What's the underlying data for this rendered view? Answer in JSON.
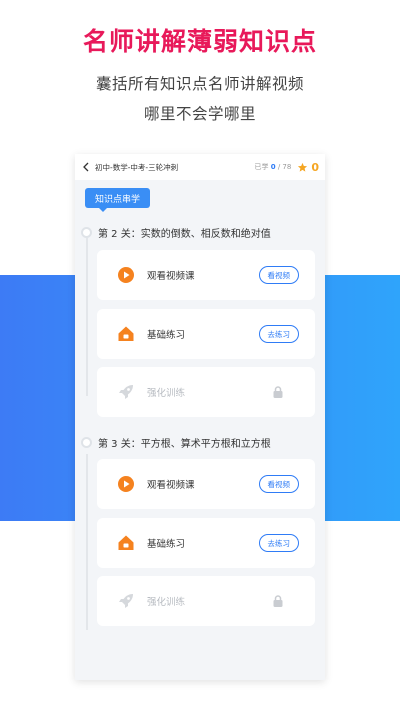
{
  "promo": {
    "headline": "名师讲解薄弱知识点",
    "sub_line1": "囊括所有知识点名师讲解视频",
    "sub_line2": "哪里不会学哪里"
  },
  "app": {
    "topbar": {
      "title": "初中-数学-中考-三轮冲刺",
      "progress_prefix": "已学",
      "progress_done": "0",
      "progress_total": "/ 78",
      "stars": "0"
    },
    "badge": "知识点串学",
    "levels": [
      {
        "title": "第 2 关：实数的倒数、相反数和绝对值",
        "items": [
          {
            "label": "观看视频课",
            "action": "看视频"
          },
          {
            "label": "基础练习",
            "action": "去练习"
          },
          {
            "label": "强化训练",
            "locked": true
          }
        ]
      },
      {
        "title": "第 3 关：平方根、算术平方根和立方根",
        "items": [
          {
            "label": "观看视频课",
            "action": "看视频"
          },
          {
            "label": "基础练习",
            "action": "去练习"
          },
          {
            "label": "强化训练",
            "locked": true
          }
        ]
      }
    ]
  },
  "colors": {
    "headline": "#e8195a",
    "accent_blue": "#2f7cf6",
    "band_start": "#3d7bf5",
    "band_end": "#2fa4fb",
    "video_icon": "#f5821f",
    "practice_icon": "#f5821f",
    "star": "#f5a623"
  },
  "icons": {
    "back": "chevron-left-icon",
    "star": "star-icon",
    "video": "play-circle-icon",
    "practice": "house-icon",
    "training": "rocket-icon",
    "locked": "lock-icon"
  }
}
